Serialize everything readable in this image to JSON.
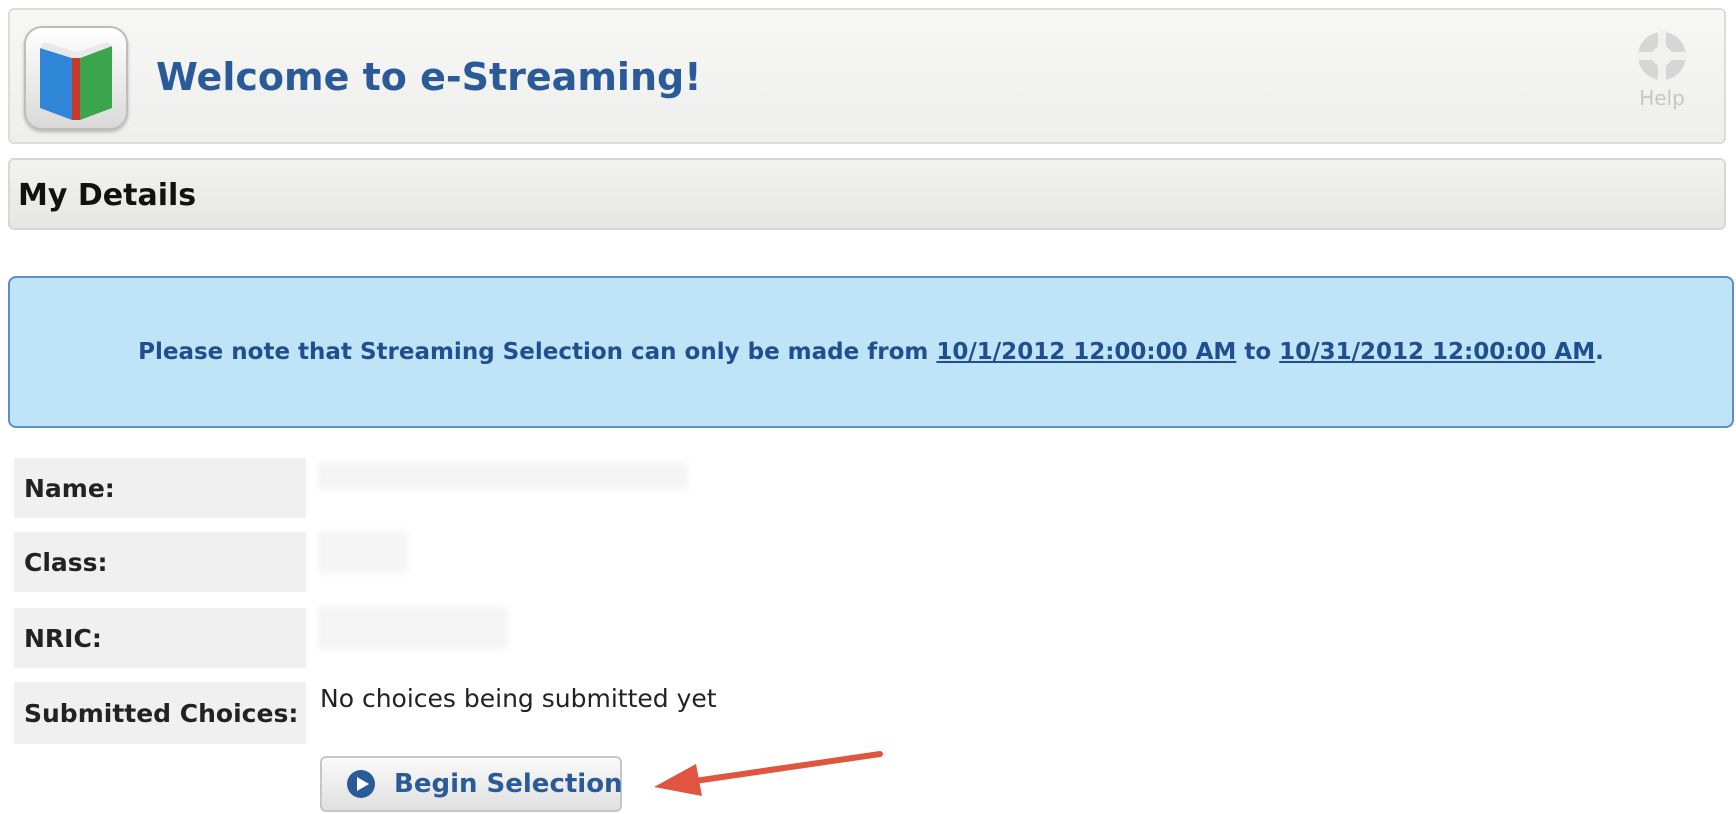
{
  "header": {
    "title": "Welcome to e-Streaming!",
    "help_label": "Help",
    "app_icon": "book-icon",
    "help_icon": "lifebuoy-icon"
  },
  "section": {
    "title": "My Details"
  },
  "notice": {
    "prefix": "Please note that Streaming Selection can only be made from",
    "start": "10/1/2012 12:00:00 AM",
    "connector": "to",
    "end": "10/31/2012 12:00:00 AM",
    "suffix": "."
  },
  "details": {
    "name_label": "Name:",
    "class_label": "Class:",
    "nric_label": "NRIC:",
    "submitted_label": "Submitted Choices:",
    "submitted_value": "No choices being submitted yet"
  },
  "actions": {
    "begin_label": "Begin Selection",
    "begin_icon": "play-circle-icon"
  },
  "colors": {
    "title_blue": "#2a5b98",
    "notice_bg": "#bfe3f7",
    "notice_border": "#5f8fc1",
    "annotation_arrow": "#e0553f"
  }
}
